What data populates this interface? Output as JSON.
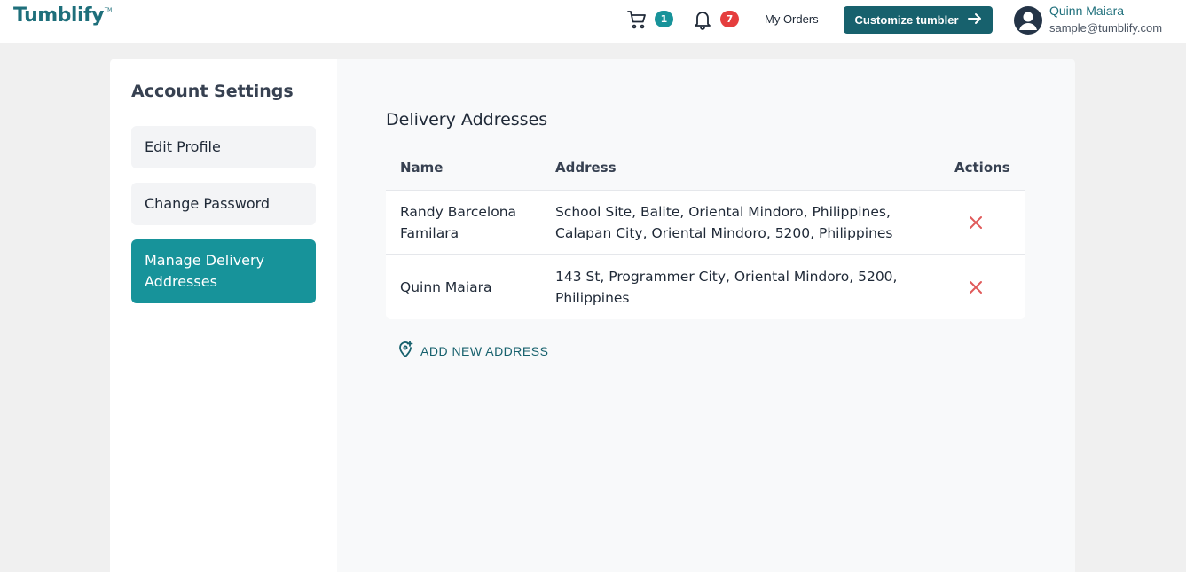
{
  "header": {
    "logo": "Tumblify",
    "logo_tm": "TM",
    "cart_count": "1",
    "notification_count": "7",
    "my_orders": "My Orders",
    "customize_label": "Customize tumbler",
    "user_name": "Quinn Maiara",
    "user_email": "sample@tumblify.com"
  },
  "sidebar": {
    "title": "Account Settings",
    "items": [
      {
        "label": "Edit Profile"
      },
      {
        "label": "Change Password"
      },
      {
        "label": "Manage Delivery Addresses"
      }
    ]
  },
  "main": {
    "title": "Delivery Addresses",
    "columns": [
      "Name",
      "Address",
      "Actions"
    ],
    "rows": [
      {
        "name": "Randy Barcelona Familara",
        "address": "School Site, Balite, Oriental Mindoro, Philippines, Calapan City, Oriental Mindoro, 5200, Philippines"
      },
      {
        "name": "Quinn Maiara",
        "address": "143 St, Programmer City, Oriental Mindoro, 5200, Philippines"
      }
    ],
    "add_label": "ADD NEW ADDRESS"
  },
  "colors": {
    "brand": "#17616d",
    "active_item": "#17939a",
    "cart_badge": "#17939a",
    "notification_badge": "#e53e3e",
    "delete": "#e05a5a"
  },
  "icons": [
    "cart-icon",
    "bell-icon",
    "arrow-right-icon",
    "user-avatar-icon",
    "close-icon",
    "add-location-icon"
  ]
}
